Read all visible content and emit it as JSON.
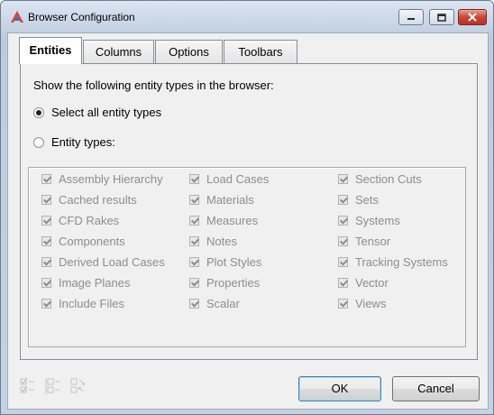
{
  "window": {
    "title": "Browser Configuration"
  },
  "tabs": [
    "Entities",
    "Columns",
    "Options",
    "Toolbars"
  ],
  "entities_tab": {
    "prompt": "Show the following entity types in the browser:",
    "radio_all": "Select all entity types",
    "radio_types": "Entity types:",
    "columns": [
      [
        "Assembly Hierarchy",
        "Cached results",
        "CFD Rakes",
        "Components",
        "Derived Load Cases",
        "Image Planes",
        "Include Files"
      ],
      [
        "Load Cases",
        "Materials",
        "Measures",
        "Notes",
        "Plot Styles",
        "Properties",
        "Scalar"
      ],
      [
        "Section Cuts",
        "Sets",
        "Systems",
        "Tensor",
        "Tracking Systems",
        "Vector",
        "Views"
      ]
    ]
  },
  "buttons": {
    "ok": "OK",
    "cancel": "Cancel"
  },
  "colors": {
    "close_button": "#c9473a",
    "disabled_text": "#8d8d8d",
    "dialog_bg": "#f0f0f0"
  }
}
